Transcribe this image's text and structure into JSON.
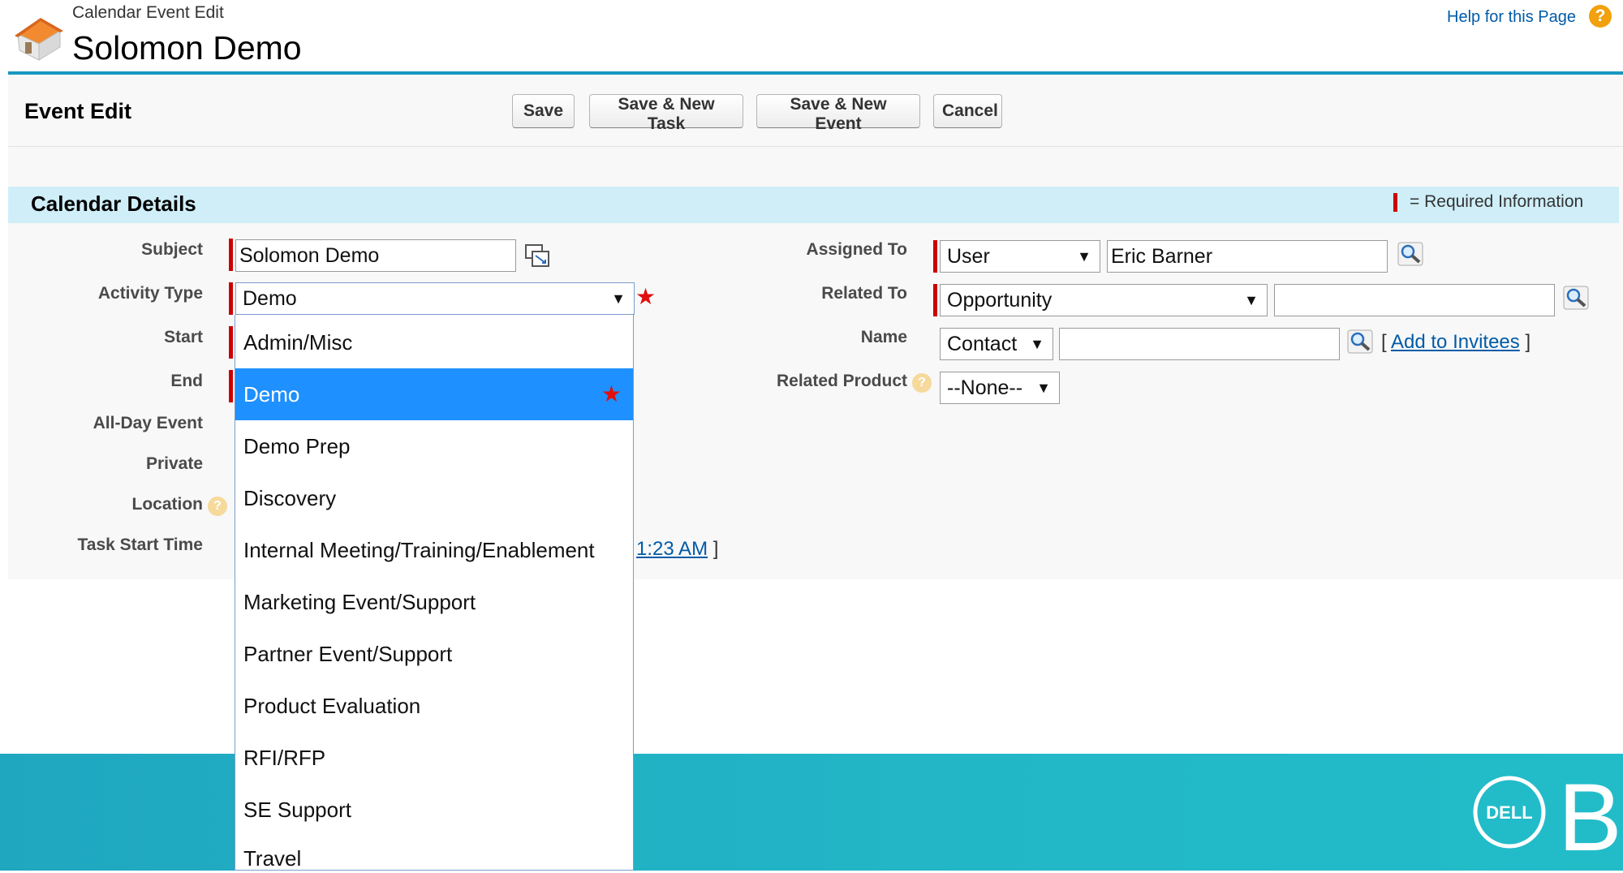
{
  "header": {
    "breadcrumb": "Calendar Event Edit",
    "title": "Solomon Demo",
    "help_link": "Help for this Page",
    "help_icon": "?"
  },
  "block": {
    "title": "Event Edit",
    "buttons": {
      "save": "Save",
      "save_new_task": "Save & New Task",
      "save_new_event": "Save & New Event",
      "cancel": "Cancel"
    }
  },
  "section": {
    "title": "Calendar Details",
    "required_legend": "= Required Information"
  },
  "left_fields": {
    "subject": {
      "label": "Subject",
      "value": "Solomon Demo"
    },
    "activity_type": {
      "label": "Activity Type",
      "value": "Demo"
    },
    "start": {
      "label": "Start"
    },
    "end": {
      "label": "End"
    },
    "all_day": {
      "label": "All-Day Event"
    },
    "private": {
      "label": "Private"
    },
    "location": {
      "label": "Location"
    },
    "task_start_time": {
      "label": "Task Start Time",
      "partial_value": "1:23 AM",
      "bracket": "]"
    }
  },
  "right_fields": {
    "assigned_to": {
      "label": "Assigned To",
      "type_value": "User",
      "value": "Eric Barner"
    },
    "related_to": {
      "label": "Related To",
      "type_value": "Opportunity",
      "value": ""
    },
    "name": {
      "label": "Name",
      "type_value": "Contact",
      "value": "",
      "add_invitees_open": "[",
      "add_invitees": "Add to Invitees",
      "add_invitees_close": "]"
    },
    "related_product": {
      "label": "Related Product",
      "value": "--None--"
    }
  },
  "dropdown": {
    "options": [
      "Admin/Misc",
      "Demo",
      "Demo Prep",
      "Discovery",
      "Internal Meeting/Training/Enablement",
      "Marketing Event/Support",
      "Partner Event/Support",
      "Product Evaluation",
      "RFI/RFP",
      "SE Support",
      "Travel"
    ],
    "selected": "Demo",
    "selected_index": 1
  },
  "footer": {
    "logo": "DELL",
    "letter": "B"
  },
  "colors": {
    "accent_rule": "#1797c0",
    "section_bg": "#cfeef8",
    "required": "#cc0000",
    "selected_option": "#1e90ff",
    "footer": "#22b7c7"
  }
}
